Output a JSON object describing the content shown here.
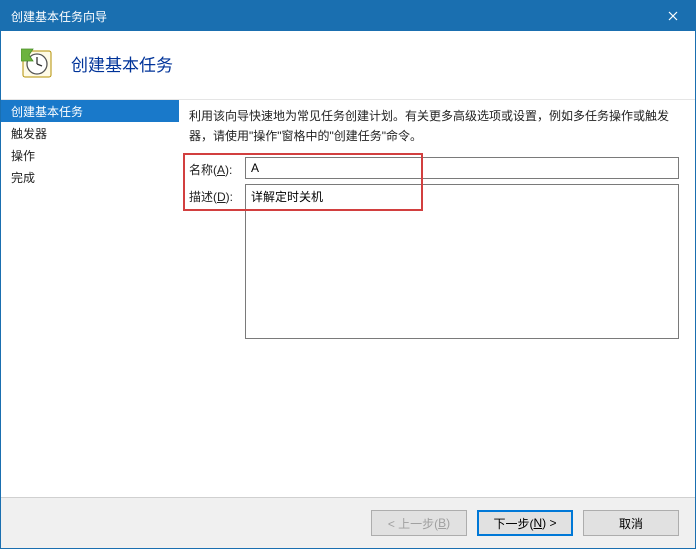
{
  "titlebar": {
    "text": "创建基本任务向导"
  },
  "header": {
    "title": "创建基本任务"
  },
  "sidebar": {
    "items": [
      {
        "label": "创建基本任务",
        "active": true
      },
      {
        "label": "触发器",
        "active": false
      },
      {
        "label": "操作",
        "active": false
      },
      {
        "label": "完成",
        "active": false
      }
    ]
  },
  "main": {
    "instruction": "利用该向导快速地为常见任务创建计划。有关更多高级选项或设置，例如多任务操作或触发器，请使用\"操作\"窗格中的\"创建任务\"命令。",
    "name_label_prefix": "名称(",
    "name_label_key": "A",
    "name_label_suffix": "):",
    "name_value": "A",
    "desc_label_prefix": "描述(",
    "desc_label_key": "D",
    "desc_label_suffix": "):",
    "desc_value": "详解定时关机"
  },
  "footer": {
    "back_prefix": "< 上一步(",
    "back_key": "B",
    "back_suffix": ")",
    "next_prefix": "下一步(",
    "next_key": "N",
    "next_suffix": ") >",
    "cancel": "取消"
  }
}
